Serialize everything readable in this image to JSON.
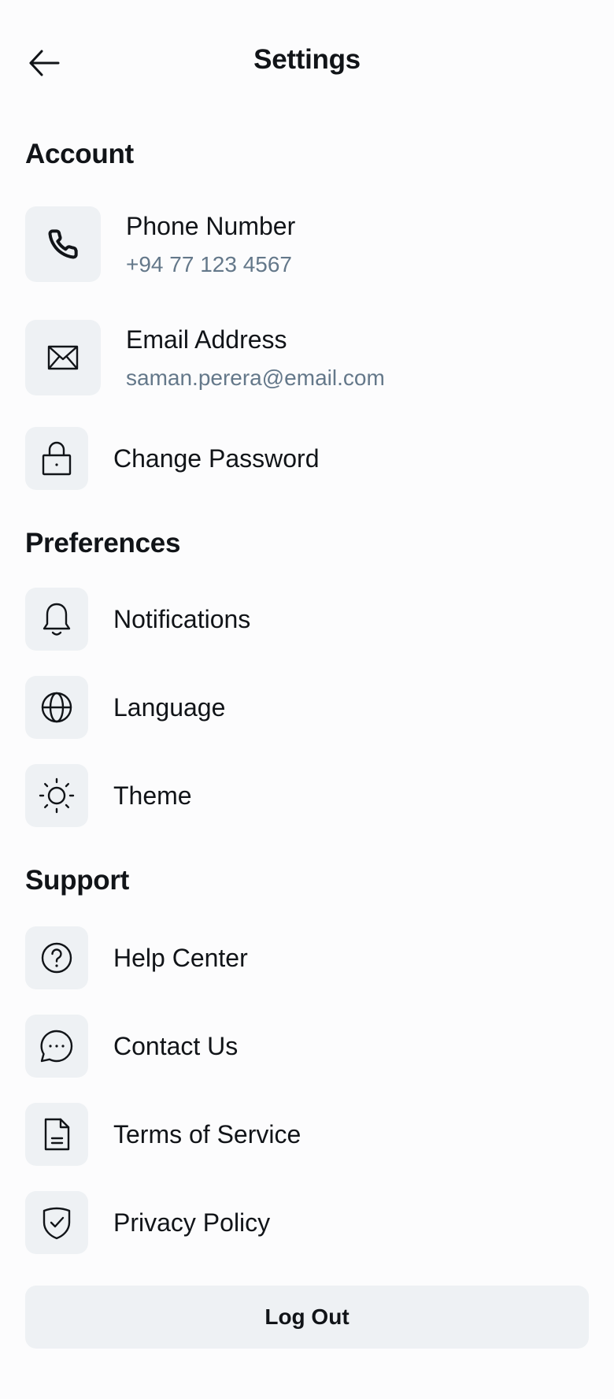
{
  "header": {
    "title": "Settings",
    "back_icon": "arrow-left-icon"
  },
  "account": {
    "title": "Account",
    "phone": {
      "label": "Phone Number",
      "value": "+94 77 123 4567",
      "icon": "phone-icon"
    },
    "email": {
      "label": "Email Address",
      "value": "saman.perera@email.com",
      "icon": "mail-icon"
    },
    "password": {
      "label": "Change Password",
      "icon": "lock-icon"
    }
  },
  "preferences": {
    "title": "Preferences",
    "items": [
      {
        "label": "Notifications",
        "icon": "bell-icon"
      },
      {
        "label": "Language",
        "icon": "globe-icon"
      },
      {
        "label": "Theme",
        "icon": "sun-icon"
      }
    ]
  },
  "support": {
    "title": "Support",
    "items": [
      {
        "label": "Help Center",
        "icon": "help-circle-icon"
      },
      {
        "label": "Contact Us",
        "icon": "message-circle-icon"
      },
      {
        "label": "Terms of Service",
        "icon": "document-icon"
      },
      {
        "label": "Privacy Policy",
        "icon": "shield-check-icon"
      }
    ]
  },
  "logout_label": "Log Out",
  "colors": {
    "tile_background": "#eef1f4",
    "secondary_text": "#64788a",
    "primary_text": "#111418"
  }
}
